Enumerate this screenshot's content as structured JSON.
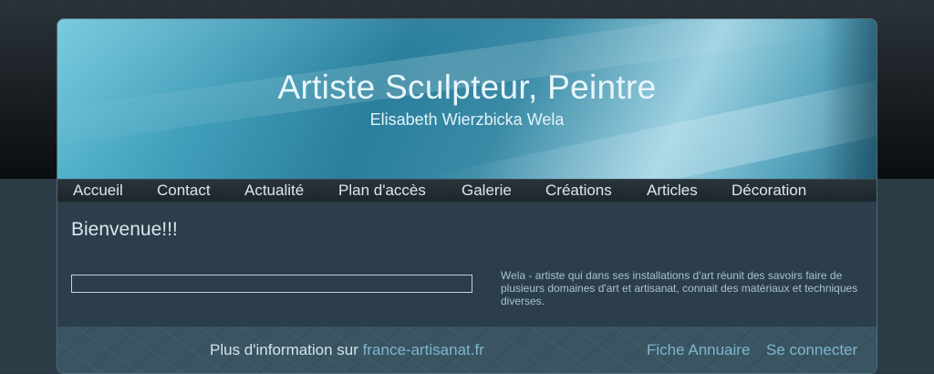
{
  "header": {
    "title": "Artiste Sculpteur, Peintre",
    "subtitle": "Elisabeth Wierzbicka Wela"
  },
  "nav": {
    "items": [
      "Accueil",
      "Contact",
      "Actualité",
      "Plan d'accès",
      "Galerie",
      "Créations",
      "Articles",
      "Décoration"
    ]
  },
  "content": {
    "heading": "Bienvenue!!!",
    "input_value": "",
    "description": "Wela - artiste qui dans ses installations d'art réunit des savoirs faire de plusieurs domaines d'art et artisanat, connait des matériaux et techniques diverses."
  },
  "footer": {
    "info_prefix": "Plus d'information sur ",
    "info_link": "france-artisanat.fr",
    "annuaire_link": "Fiche Annuaire",
    "login_link": "Se connecter"
  },
  "colors": {
    "accent_link": "#7fb6cc",
    "header_blue": "#3f9cb8",
    "page_bg": "#2b3c46"
  }
}
